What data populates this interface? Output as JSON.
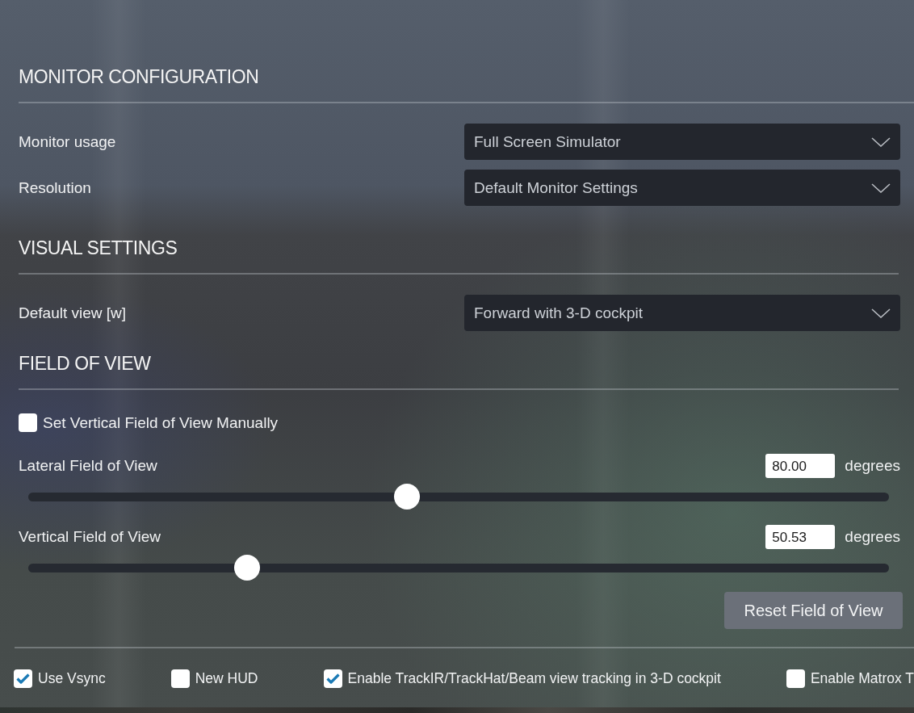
{
  "sections": [
    {
      "title": "MONITOR CONFIGURATION",
      "rows": [
        {
          "kind": "dropdown",
          "label": "Monitor usage",
          "value": "Full Screen Simulator"
        },
        {
          "kind": "dropdown",
          "label": "Resolution",
          "value": "Default Monitor Settings"
        }
      ]
    },
    {
      "title": "VISUAL SETTINGS",
      "rows": [
        {
          "kind": "dropdown",
          "label": "Default view [w]",
          "value": "Forward with 3-D cockpit"
        }
      ]
    },
    {
      "title": "FIELD OF VIEW",
      "rows": [
        {
          "kind": "checkbox",
          "label": "Set Vertical Field of View Manually",
          "checked": false
        },
        {
          "kind": "slider",
          "label": "Lateral Field of View",
          "value": "80.00",
          "unit": "degrees",
          "level": 0.44
        },
        {
          "kind": "slider",
          "label": "Vertical Field of View",
          "value": "50.53",
          "unit": "degrees",
          "level": 0.254
        },
        {
          "kind": "button",
          "label": "Reset Field of View"
        }
      ]
    }
  ],
  "options": [
    {
      "label": "Use Vsync",
      "checked": true
    },
    {
      "label": "New HUD",
      "checked": false
    },
    {
      "label": "Enable TrackIR/TrackHat/Beam view tracking in 3-D cockpit",
      "checked": true
    },
    {
      "label": "Enable Matrox T",
      "checked": false
    }
  ]
}
